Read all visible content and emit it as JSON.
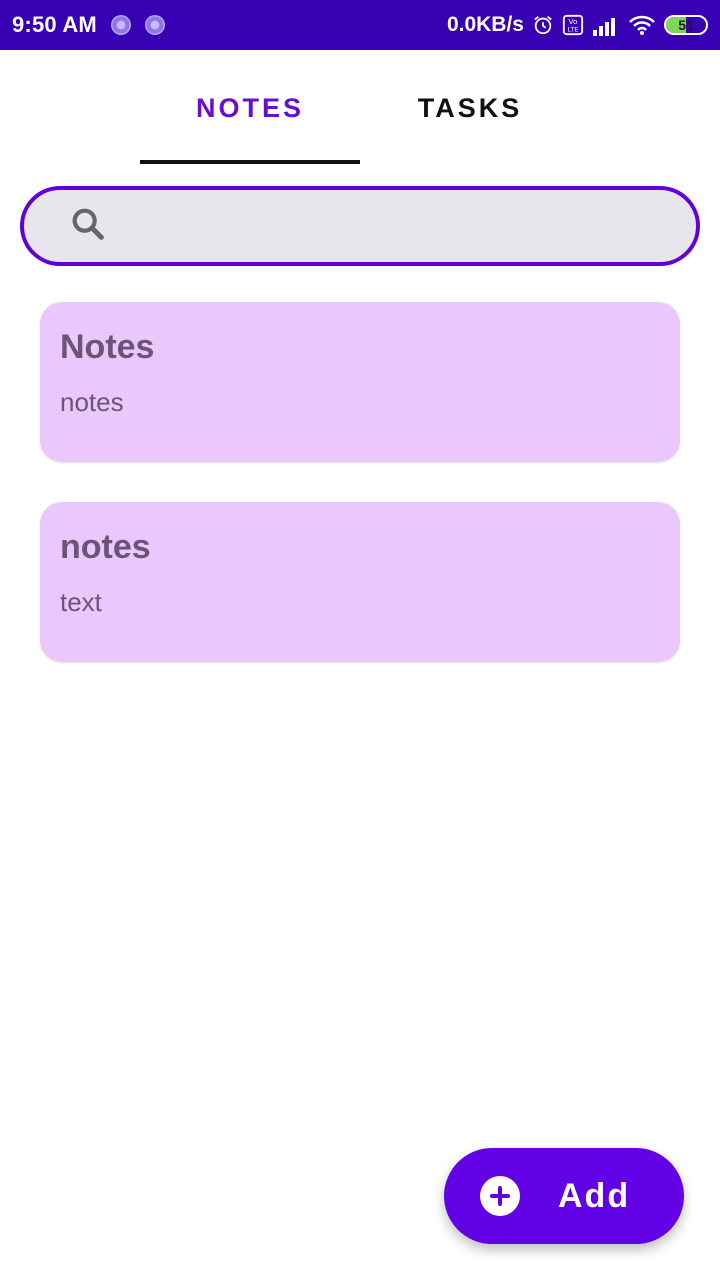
{
  "status_bar": {
    "time": "9:50 AM",
    "net_speed": "0.0KB/s",
    "battery_level": "51",
    "battery_fraction": 0.51,
    "icons": [
      "notification-dot-icon",
      "notification-dot-icon",
      "alarm-icon",
      "volte-icon",
      "signal-icon",
      "wifi-icon",
      "battery-icon"
    ]
  },
  "tabs": [
    {
      "label": "NOTES",
      "selected": true
    },
    {
      "label": "TASKS",
      "selected": false
    }
  ],
  "search": {
    "icon": "search-icon",
    "value": "",
    "placeholder": ""
  },
  "notes": [
    {
      "title": "Notes",
      "body": "notes"
    },
    {
      "title": "notes",
      "body": "text"
    }
  ],
  "fab": {
    "icon": "add-circle-icon",
    "label": "Add"
  },
  "colors": {
    "status_bar": "#3700b3",
    "accent": "#6200e6",
    "selected_tab": "#6a0dcf",
    "card": "#eac8fd",
    "search_bg": "#e8e6ec"
  }
}
